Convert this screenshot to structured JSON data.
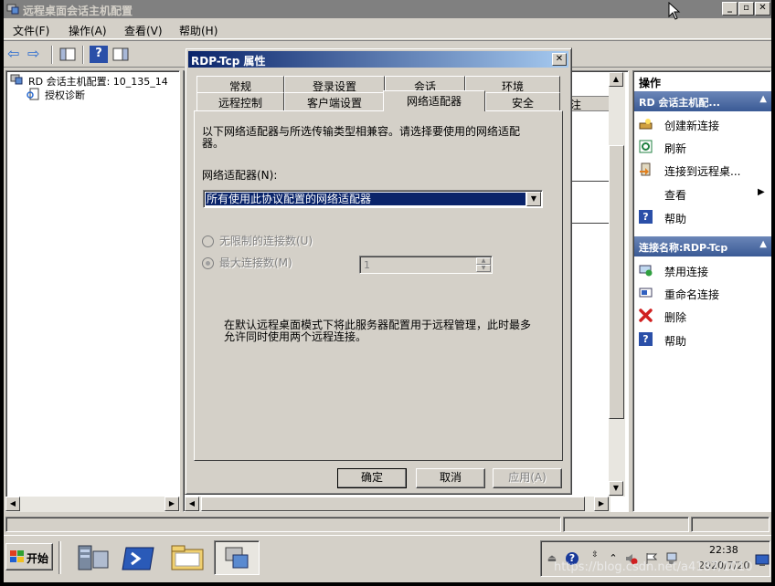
{
  "window": {
    "title": "远程桌面会话主机配置",
    "min_glyph": "_",
    "max_glyph": "▫",
    "close_glyph": "✕"
  },
  "menu": [
    "文件(F)",
    "操作(A)",
    "查看(V)",
    "帮助(H)"
  ],
  "toolbar": {
    "back_glyph": "⇦",
    "forward_glyph": "⇨",
    "help_glyph": "?"
  },
  "tree": {
    "root": "RD 会话主机配置: 10_135_14",
    "child": "授权诊断"
  },
  "center": {
    "column_partial": "注"
  },
  "actions": {
    "header": "操作",
    "section1": {
      "title": "RD 会话主机配...",
      "items": [
        "创建新连接",
        "刷新",
        "连接到远程桌...",
        "查看",
        "帮助"
      ]
    },
    "section2": {
      "title": "连接名称:RDP-Tcp",
      "items": [
        "禁用连接",
        "重命名连接",
        "删除",
        "帮助"
      ]
    },
    "collapse_glyph": "▲",
    "submenu_glyph": "▶"
  },
  "dialog": {
    "title": "RDP-Tcp 属性",
    "tabs_row1": [
      "常规",
      "登录设置",
      "会话",
      "环境"
    ],
    "tabs_row2": [
      "远程控制",
      "客户端设置",
      "网络适配器",
      "安全"
    ],
    "active_tab": "网络适配器",
    "description": "以下网络适配器与所选传输类型相兼容。请选择要使用的网络适配器。",
    "adapter_label": "网络适配器(N):",
    "adapter_value": "所有使用此协议配置的网络适配器",
    "radio_unlimited": "无限制的连接数(U)",
    "radio_max": "最大连接数(M)",
    "max_value": "1",
    "note": "在默认远程桌面模式下将此服务器配置用于远程管理，此时最多允许同时使用两个远程连接。",
    "buttons": {
      "ok": "确定",
      "cancel": "取消",
      "apply": "应用(A)"
    },
    "close_glyph": "✕"
  },
  "taskbar": {
    "start_label": "开始",
    "clock_time": "22:38",
    "clock_date": "2020/7/20"
  },
  "watermark": "https://blog.csdn.net/a4187/1010"
}
